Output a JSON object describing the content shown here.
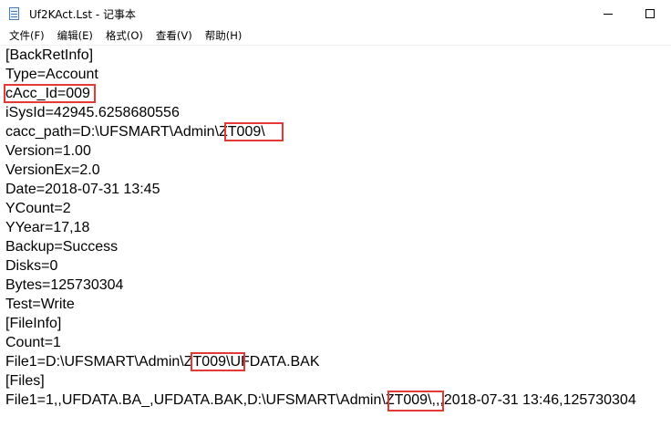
{
  "window": {
    "title": "Uf2KAct.Lst - 记事本",
    "icon": "notepad-icon",
    "controls": [
      "minimize-icon",
      "maximize-icon",
      "close-icon"
    ]
  },
  "menu": [
    {
      "label": "文件(F)"
    },
    {
      "label": "编辑(E)"
    },
    {
      "label": "格式(O)"
    },
    {
      "label": "查看(V)"
    },
    {
      "label": "帮助(H)"
    }
  ],
  "editor": {
    "lines": [
      "[BackRetInfo]",
      "Type=Account",
      "cAcc_Id=009",
      "iSysId=42945.6258680556",
      "cacc_path=D:\\UFSMART\\Admin\\ZT009\\",
      "Version=1.00",
      "VersionEx=2.0",
      "Date=2018-07-31 13:45",
      "YCount=2",
      "YYear=17,18",
      "Backup=Success",
      "Disks=0",
      "Bytes=125730304",
      "Test=Write",
      "[FileInfo]",
      "Count=1",
      "File1=D:\\UFSMART\\Admin\\ZT009\\UFDATA.BAK",
      "[Files]",
      "File1=1,,UFDATA.BA_,UFDATA.BAK,D:\\UFSMART\\Admin\\ZT009\\,,,2018-07-31 13:46,125730304"
    ],
    "highlight_color": "#e53935"
  }
}
